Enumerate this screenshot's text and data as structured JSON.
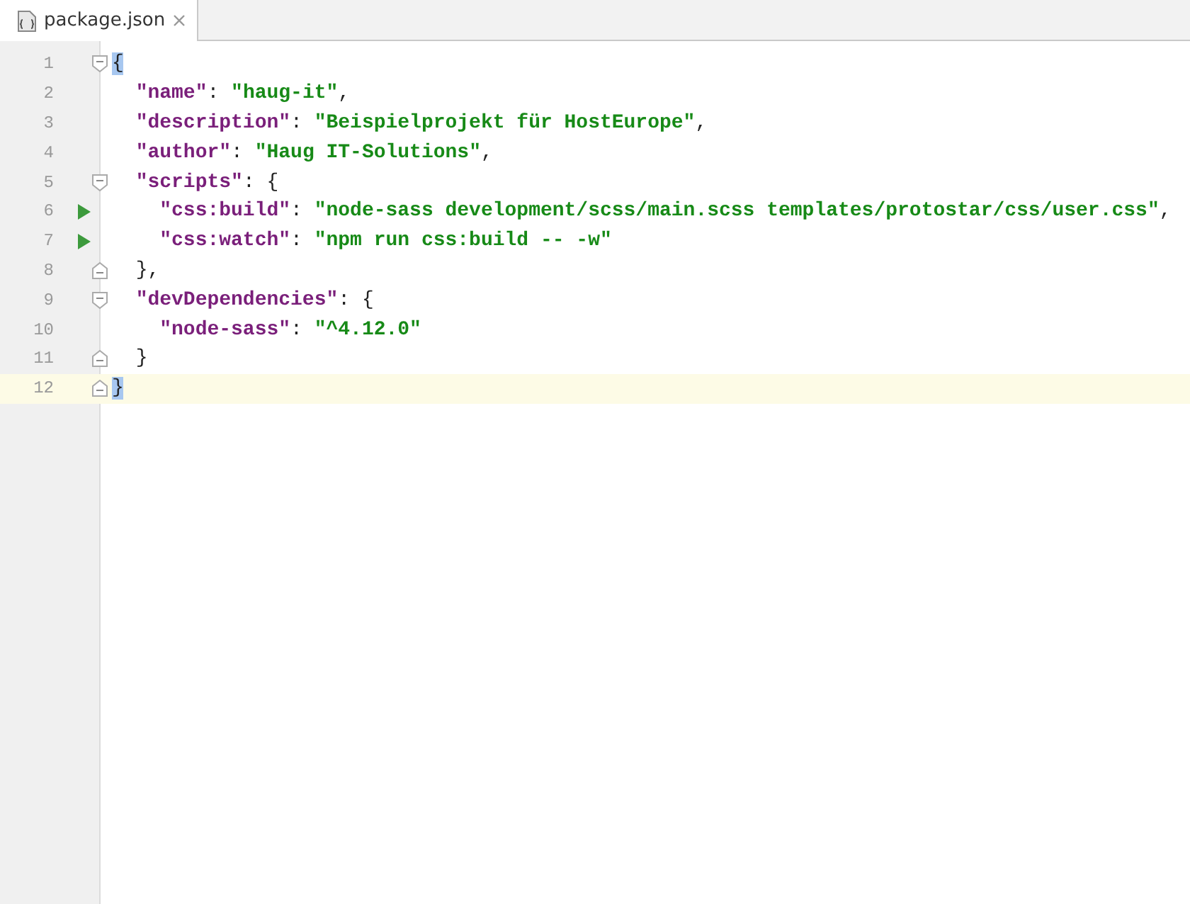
{
  "tabs": [
    {
      "label": "package.json",
      "selected": true
    }
  ],
  "lines": [
    {
      "number": "1",
      "fold_open": true,
      "fold_close": false,
      "run": false,
      "current": false,
      "tokens": [
        {
          "kind": "brace",
          "text": "{"
        }
      ]
    },
    {
      "number": "2",
      "fold_open": false,
      "fold_close": false,
      "run": false,
      "current": false,
      "tokens": [
        {
          "kind": "key",
          "text": "  \"name\""
        },
        {
          "kind": "punct",
          "text": ": "
        },
        {
          "kind": "string",
          "text": "\"haug-it\""
        },
        {
          "kind": "punct",
          "text": ","
        }
      ]
    },
    {
      "number": "3",
      "fold_open": false,
      "fold_close": false,
      "run": false,
      "current": false,
      "tokens": [
        {
          "kind": "key",
          "text": "  \"description\""
        },
        {
          "kind": "punct",
          "text": ": "
        },
        {
          "kind": "string",
          "text": "\"Beispielprojekt für HostEurope\""
        },
        {
          "kind": "punct",
          "text": ","
        }
      ]
    },
    {
      "number": "4",
      "fold_open": false,
      "fold_close": false,
      "run": false,
      "current": false,
      "tokens": [
        {
          "kind": "key",
          "text": "  \"author\""
        },
        {
          "kind": "punct",
          "text": ": "
        },
        {
          "kind": "string",
          "text": "\"Haug IT-Solutions\""
        },
        {
          "kind": "punct",
          "text": ","
        }
      ]
    },
    {
      "number": "5",
      "fold_open": true,
      "fold_close": false,
      "run": false,
      "current": false,
      "tokens": [
        {
          "kind": "key",
          "text": "  \"scripts\""
        },
        {
          "kind": "punct",
          "text": ": {"
        }
      ]
    },
    {
      "number": "6",
      "fold_open": false,
      "fold_close": false,
      "run": true,
      "current": false,
      "tokens": [
        {
          "kind": "key",
          "text": "    \"css:build\""
        },
        {
          "kind": "punct",
          "text": ": "
        },
        {
          "kind": "string",
          "text": "\"node-sass development/scss/main.scss templates/protostar/css/user.css\""
        },
        {
          "kind": "punct",
          "text": ","
        }
      ]
    },
    {
      "number": "7",
      "fold_open": false,
      "fold_close": false,
      "run": true,
      "current": false,
      "tokens": [
        {
          "kind": "key",
          "text": "    \"css:watch\""
        },
        {
          "kind": "punct",
          "text": ": "
        },
        {
          "kind": "string",
          "text": "\"npm run css:build -- -w\""
        }
      ]
    },
    {
      "number": "8",
      "fold_open": false,
      "fold_close": true,
      "run": false,
      "current": false,
      "tokens": [
        {
          "kind": "punct",
          "text": "  },"
        }
      ]
    },
    {
      "number": "9",
      "fold_open": true,
      "fold_close": false,
      "run": false,
      "current": false,
      "tokens": [
        {
          "kind": "key",
          "text": "  \"devDependencies\""
        },
        {
          "kind": "punct",
          "text": ": {"
        }
      ]
    },
    {
      "number": "10",
      "fold_open": false,
      "fold_close": false,
      "run": false,
      "current": false,
      "tokens": [
        {
          "kind": "key",
          "text": "    \"node-sass\""
        },
        {
          "kind": "punct",
          "text": ": "
        },
        {
          "kind": "string",
          "text": "\"^4.12.0\""
        }
      ]
    },
    {
      "number": "11",
      "fold_open": false,
      "fold_close": true,
      "run": false,
      "current": false,
      "tokens": [
        {
          "kind": "punct",
          "text": "  }"
        }
      ]
    },
    {
      "number": "12",
      "fold_open": false,
      "fold_close": true,
      "run": false,
      "current": true,
      "tokens": [
        {
          "kind": "brace",
          "text": "}"
        }
      ]
    }
  ]
}
